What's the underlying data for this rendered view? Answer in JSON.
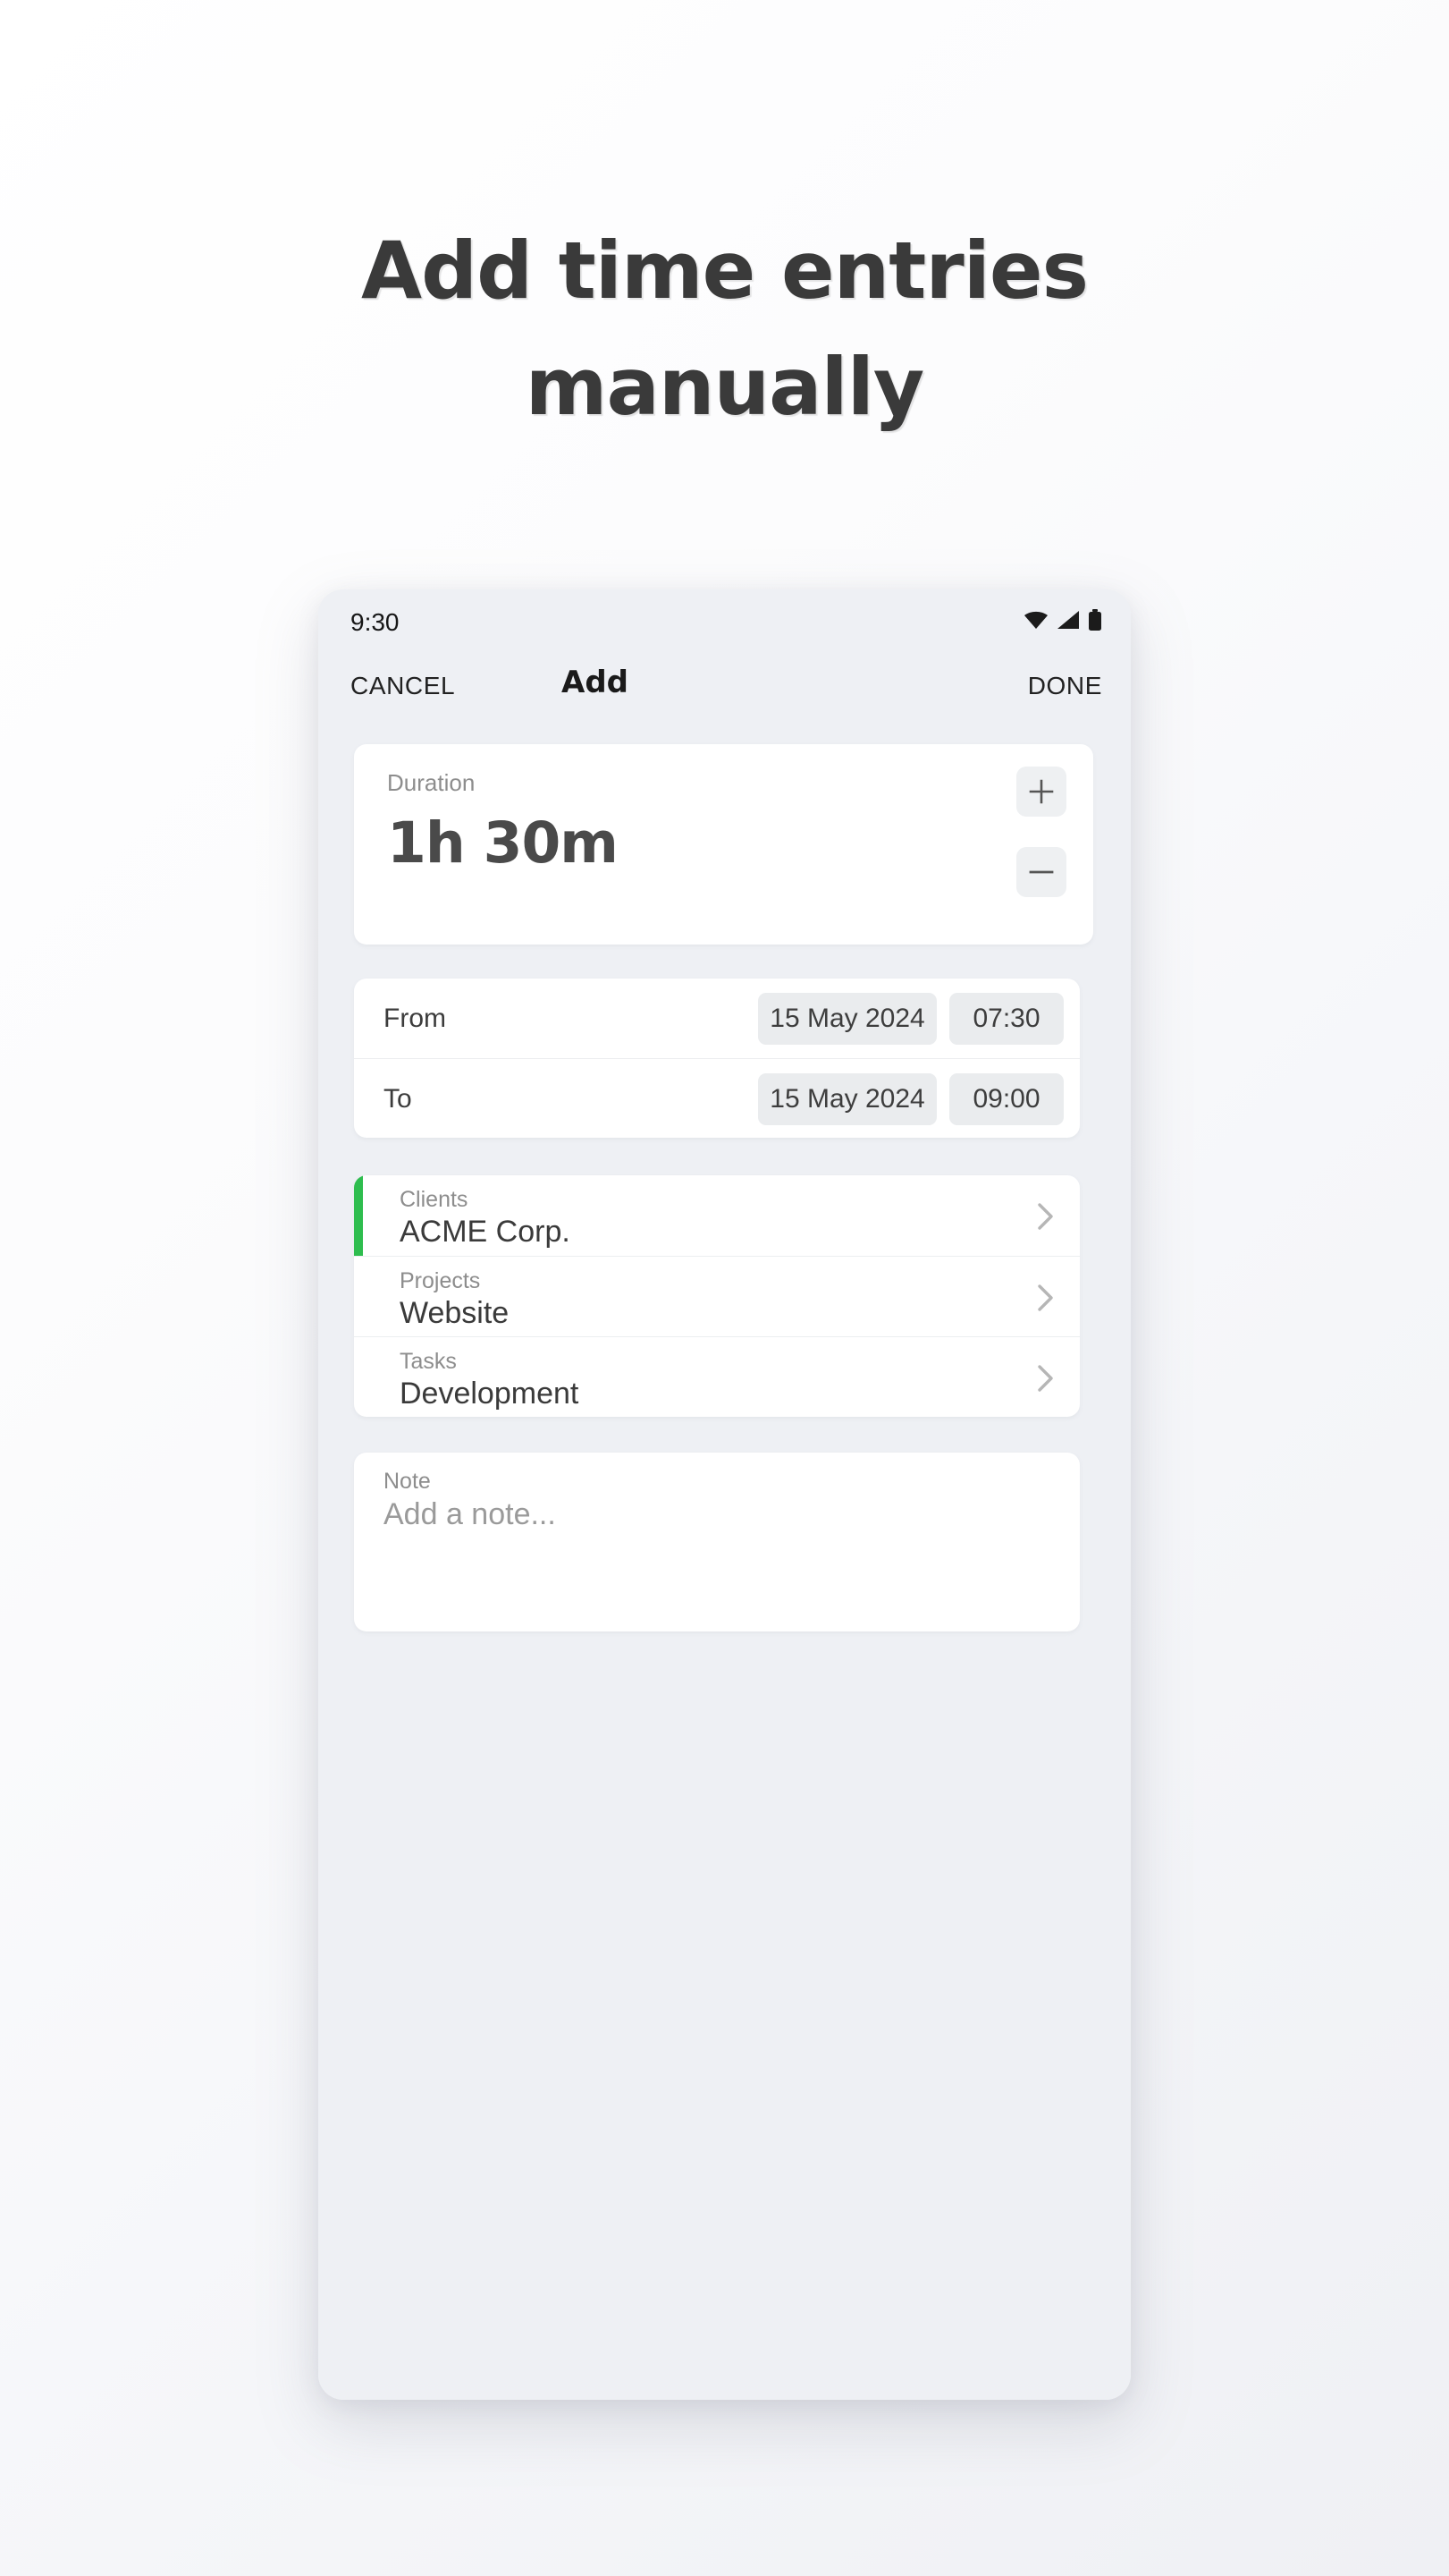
{
  "headline": {
    "line1": "Add time entries",
    "line2": "manually"
  },
  "phone": {
    "statusbar": {
      "clock": "9:30",
      "icons": [
        "wifi-icon",
        "cellular-signal-icon",
        "battery-icon"
      ]
    },
    "appbar": {
      "cancel_label": "CANCEL",
      "title": "Add",
      "done_label": "DONE"
    },
    "duration": {
      "label": "Duration",
      "value": "1h 30m",
      "increment_icon": "plus-icon",
      "decrement_icon": "minus-icon"
    },
    "range": {
      "rows": [
        {
          "label": "From",
          "date": "15 May 2024",
          "time": "07:30"
        },
        {
          "label": "To",
          "date": "15 May 2024",
          "time": "09:00"
        }
      ]
    },
    "picker": {
      "accent_color": "#2ebd4e",
      "rows": [
        {
          "label": "Clients",
          "value": "ACME Corp.",
          "chevron": "chevron-right-icon"
        },
        {
          "label": "Projects",
          "value": "Website",
          "chevron": "chevron-right-icon"
        },
        {
          "label": "Tasks",
          "value": "Development",
          "chevron": "chevron-right-icon"
        }
      ]
    },
    "note": {
      "label": "Note",
      "placeholder": "Add a note...",
      "value": ""
    }
  }
}
